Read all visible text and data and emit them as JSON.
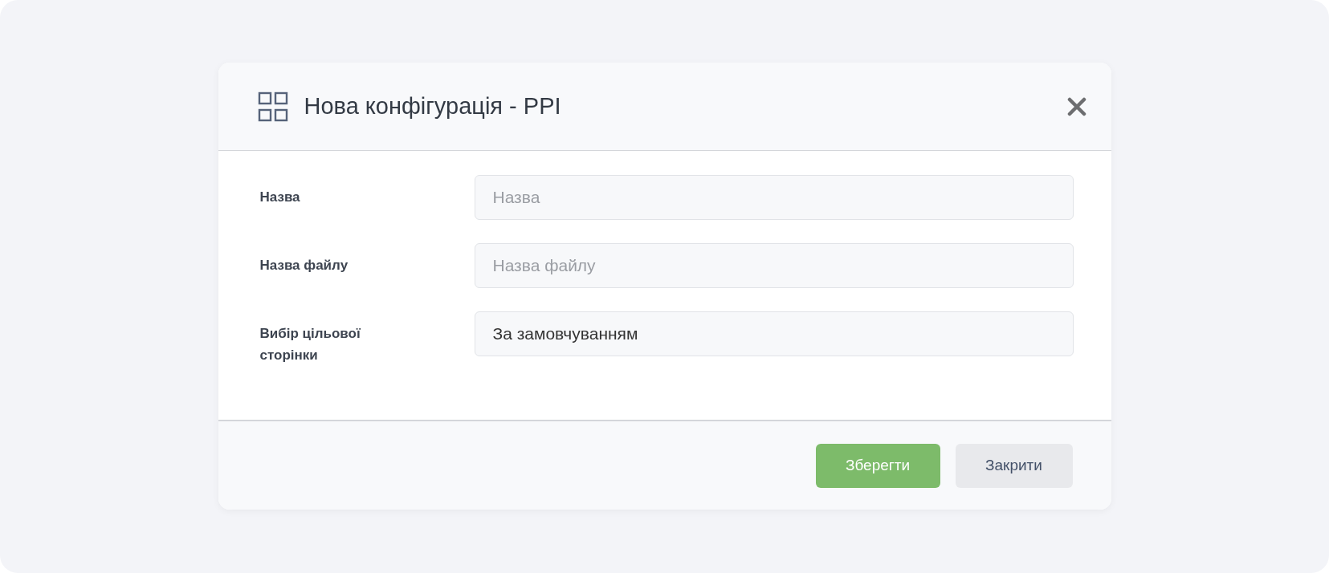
{
  "dialog": {
    "title": "Нова конфігурація - PPI",
    "fields": [
      {
        "label": "Назва",
        "placeholder": "Назва"
      },
      {
        "label": "Назва файлу",
        "placeholder": "Назва файлу"
      },
      {
        "label": "Вибір цільової сторінки",
        "value": "За замовчуванням"
      }
    ],
    "buttons": [
      {
        "label": "Зберегти",
        "kind": "primary"
      },
      {
        "label": "Закрити",
        "kind": "secondary"
      }
    ]
  }
}
